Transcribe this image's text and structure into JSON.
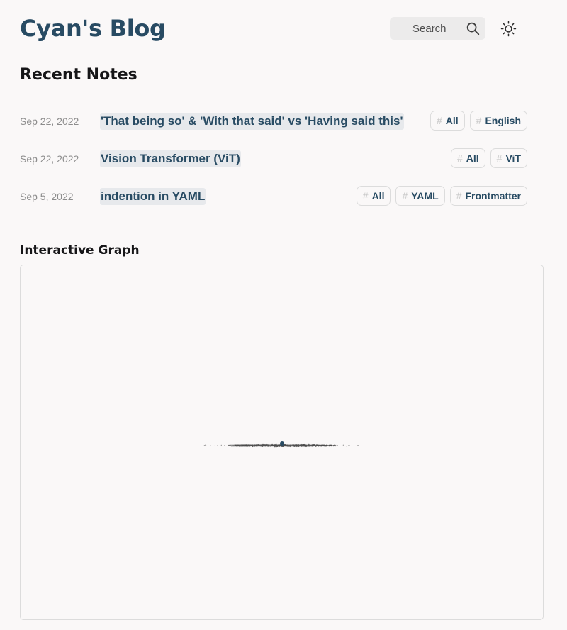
{
  "header": {
    "site_title": "Cyan's Blog",
    "search": {
      "label": "Search",
      "icon": "search-icon"
    },
    "theme_toggle": {
      "icon": "sun-icon"
    }
  },
  "recent_notes": {
    "heading": "Recent Notes",
    "items": [
      {
        "date": "Sep 22, 2022",
        "title": "'That being so' & 'With that said' vs 'Having said this'",
        "tags": [
          "All",
          "English"
        ]
      },
      {
        "date": "Sep 22, 2022",
        "title": "Vision Transformer (ViT)",
        "tags": [
          "All",
          "ViT"
        ]
      },
      {
        "date": "Sep 5, 2022",
        "title": "indention in YAML",
        "tags": [
          "All",
          "YAML",
          "Frontmatter"
        ]
      }
    ],
    "tag_prefix": "#"
  },
  "graph": {
    "heading": "Interactive Graph",
    "colors": {
      "node": "#4a4a4a",
      "current_node": "#284b63",
      "link": "#555555"
    }
  },
  "colors": {
    "accent": "#284b63",
    "background": "#faf8f8",
    "heading": "#161618",
    "muted_text": "#8c8c8c"
  }
}
